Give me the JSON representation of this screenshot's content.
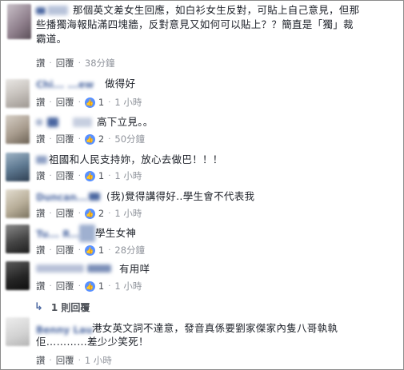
{
  "comments": [
    {
      "text_lines": [
        "那個英文差女生回應，如白衫女生反對，可貼上自己意見，但那",
        "些播獨海報貼滿四塊牆，反對意見又如何可以貼上？？簡直是「獨」裁",
        "霸道。"
      ],
      "actions": {
        "like": "讚",
        "reply": "回覆",
        "time": "38分鐘"
      }
    },
    {
      "name": "Chi... ...ew",
      "text_lines": [
        "做得好"
      ],
      "actions": {
        "like": "讚",
        "reply": "回覆",
        "count": "1",
        "time": "1 小時"
      }
    },
    {
      "text_lines": [
        "高下立見。。"
      ],
      "actions": {
        "like": "讚",
        "reply": "回覆",
        "count": "2",
        "time": "50分鐘"
      }
    },
    {
      "text_lines": [
        "祖國和人民支持妳，放心去做巴！！！"
      ],
      "actions": {
        "like": "讚",
        "reply": "回覆",
        "count": "1",
        "time": "1 小時"
      }
    },
    {
      "name": "Duncan...",
      "text_lines": [
        "(我)覺得講得好..學生會不代表我"
      ],
      "actions": {
        "like": "讚",
        "reply": "回覆",
        "count": "2",
        "time": "1 小時"
      }
    },
    {
      "name": "Tu... R...",
      "text_lines": [
        "學生女神"
      ],
      "actions": {
        "like": "讚",
        "reply": "回覆",
        "count": "1",
        "time": "28分鐘"
      }
    },
    {
      "text_lines": [
        "有用咩"
      ],
      "actions": {
        "like": "讚",
        "reply": "回覆",
        "count": "1",
        "time": "1 小時"
      }
    },
    {
      "name": "Benny Lau",
      "text_lines": [
        "港女英文詞不達意，發音真係要劉家傑家內隻八哥執執",
        "佢…………差少少笑死！"
      ],
      "actions": {
        "like": "讚",
        "reply": "回覆",
        "time": "1 小時"
      }
    }
  ],
  "reply_summary": {
    "label": "1 則回覆",
    "icon": "reply-arrow-icon"
  },
  "colors": {
    "link": "#4b67a1",
    "like_badge": "#5890ff",
    "meta": "#4b4f56",
    "time": "#90949c"
  }
}
